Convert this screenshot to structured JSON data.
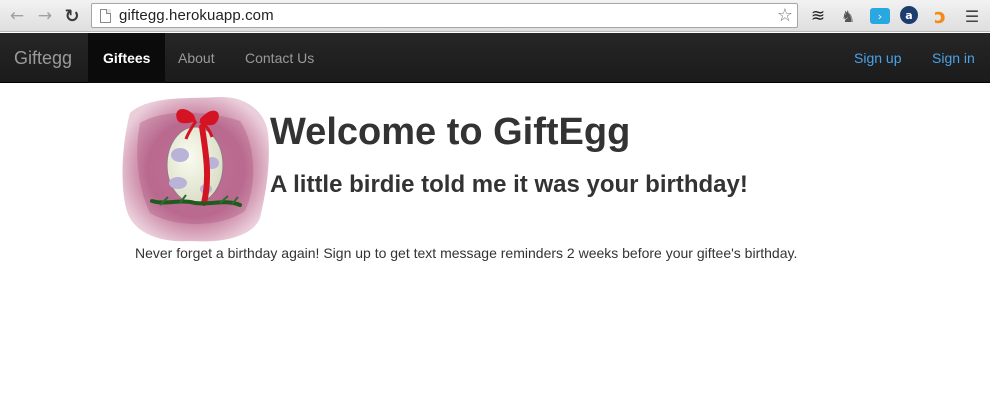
{
  "browser": {
    "url": "giftegg.herokuapp.com",
    "icons": [
      "back-arrow-icon",
      "forward-arrow-icon",
      "reload-icon",
      "page-icon",
      "star-icon",
      "layers-icon",
      "evernote-icon",
      "tag-icon",
      "a-badge-icon",
      "spiral-icon",
      "menu-icon"
    ]
  },
  "navbar": {
    "brand": "Giftegg",
    "items": [
      {
        "label": "Giftees",
        "active": true
      },
      {
        "label": "About",
        "active": false
      },
      {
        "label": "Contact Us",
        "active": false
      }
    ],
    "right_items": [
      {
        "label": "Sign up"
      },
      {
        "label": "Sign in"
      }
    ]
  },
  "main": {
    "title": "Welcome to GiftEgg",
    "subtitle": "A little birdie told me it was your birthday!",
    "lead": "Never forget a birthday again! Sign up to get text message reminders 2 weeks before your giftee's birthday."
  },
  "colors": {
    "navbar_bg": "#1b1b1b",
    "link_blue": "#4aa2e8",
    "text": "#333333"
  }
}
